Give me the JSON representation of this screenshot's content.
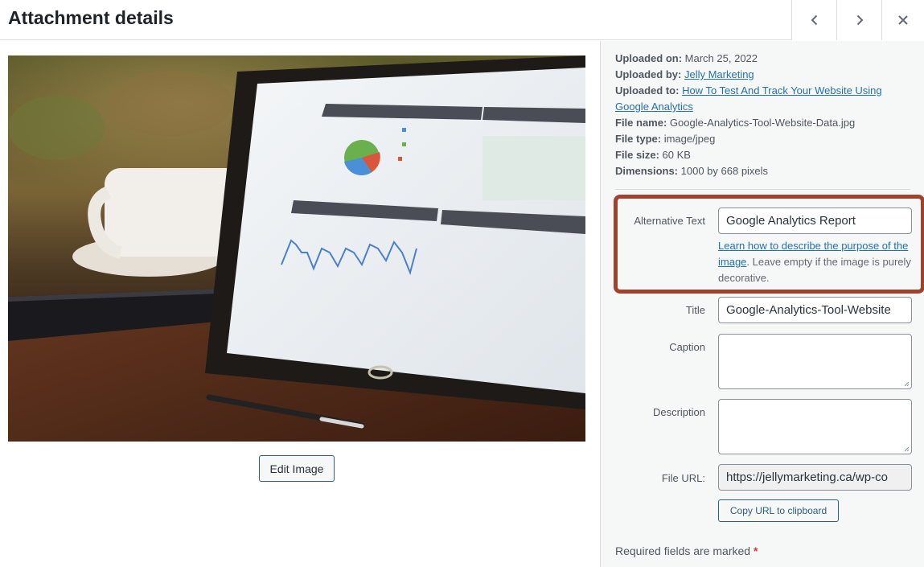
{
  "header": {
    "title": "Attachment details",
    "prev_icon": "chevron-left-icon",
    "next_icon": "chevron-right-icon",
    "close_icon": "close-icon"
  },
  "preview": {
    "image_description": "Tablet displaying Google Analytics dashboard on wooden desk with coffee cup and phone",
    "edit_button": "Edit Image"
  },
  "meta": {
    "uploaded_on_label": "Uploaded on:",
    "uploaded_on": "March 25, 2022",
    "uploaded_by_label": "Uploaded by:",
    "uploaded_by": "Jelly Marketing",
    "uploaded_to_label": "Uploaded to:",
    "uploaded_to": "How To Test And Track Your Website Using Google Analytics",
    "file_name_label": "File name:",
    "file_name": "Google-Analytics-Tool-Website-Data.jpg",
    "file_type_label": "File type:",
    "file_type": "image/jpeg",
    "file_size_label": "File size:",
    "file_size": "60 KB",
    "dimensions_label": "Dimensions:",
    "dimensions": "1000 by 668 pixels"
  },
  "fields": {
    "alt_label": "Alternative Text",
    "alt_value": "Google Analytics Report",
    "alt_help_link": "Learn how to describe the purpose of the image",
    "alt_help_rest": ". Leave empty if the image is purely decorative.",
    "title_label": "Title",
    "title_value": "Google-Analytics-Tool-Website",
    "caption_label": "Caption",
    "caption_value": "",
    "description_label": "Description",
    "description_value": "",
    "file_url_label": "File URL:",
    "file_url_value": "https://jellymarketing.ca/wp-co",
    "copy_button": "Copy URL to clipboard"
  },
  "footer": {
    "required_text": "Required fields are marked",
    "required_star": "*"
  },
  "colors": {
    "highlight_border": "#a0432d",
    "link": "#2271b1",
    "button_border": "#2c5e80",
    "required_star": "#d63638"
  }
}
